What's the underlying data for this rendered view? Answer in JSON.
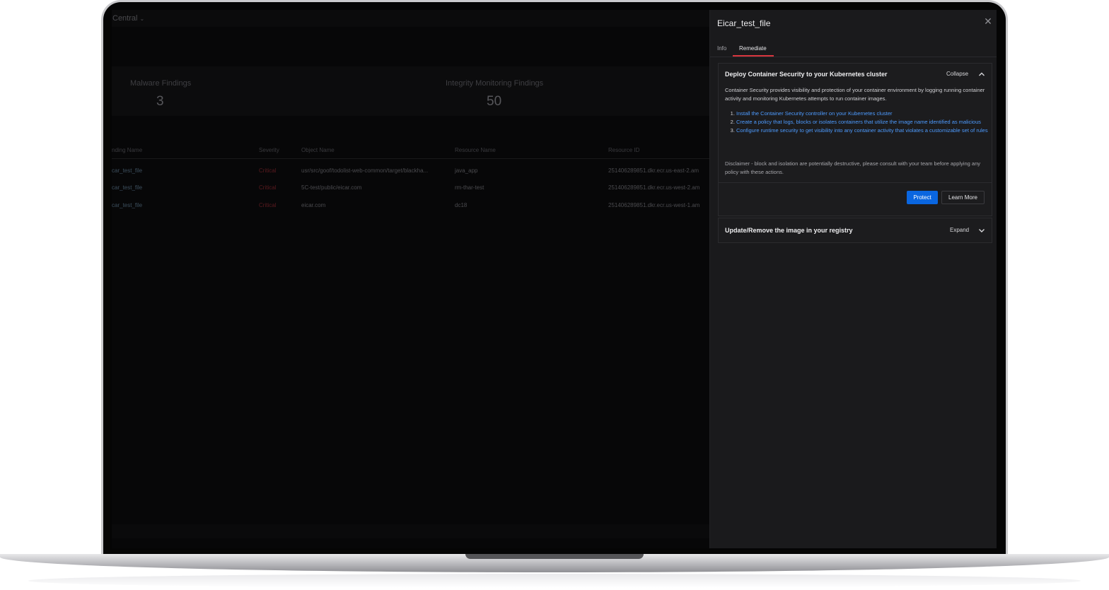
{
  "app": {
    "workspace": "Central",
    "stats": [
      {
        "label": "Malware Findings",
        "value": "3"
      },
      {
        "label": "Integrity Monitoring Findings",
        "value": "50"
      }
    ],
    "table": {
      "headers": [
        "nding Name",
        "Severity",
        "Object Name",
        "Resource Name",
        "Resource ID"
      ],
      "rows": [
        [
          "car_test_file",
          "Critical",
          "usr/src/goof/todolist-web-common/target/blackha...",
          "java_app",
          "251406289851.dkr.ecr.us-east-2.am"
        ],
        [
          "car_test_file",
          "Critical",
          "5C-test/public/eicar.com",
          "rm-thar-test",
          "251406289851.dkr.ecr.us-west-2.am"
        ],
        [
          "car_test_file",
          "Critical",
          "eicar.com",
          "dc18",
          "251406289851.dkr.ecr.us-west-1.am"
        ]
      ]
    }
  },
  "drawer": {
    "title": "Eicar_test_file",
    "tabs": [
      "Info",
      "Remediate"
    ],
    "active_tab": "Remediate",
    "panels": [
      {
        "title": "Deploy Container Security to your Kubernetes cluster",
        "toggle": "Collapse",
        "description": "Container Security provides visibility and protection of your container environment by logging running container activity and monitoring Kubernetes attempts to run container images.",
        "steps": [
          "Install the Container Security controller on your Kubernetes cluster",
          "Create a policy that logs, blocks or isolates containers that utilize the image name identified as malicious",
          "Configure runtime security to get visibility into any container activity that violates a customizable set of rules"
        ],
        "disclaimer": "Disclaimer - block and isolation are potentially destructive, please consult with your team before applying any policy with these actions.",
        "buttons": {
          "primary": "Protect",
          "secondary": "Learn More"
        }
      },
      {
        "title": "Update/Remove the image in your registry",
        "toggle": "Expand"
      }
    ]
  },
  "colors": {
    "accent": "#0a66e0",
    "link": "#4d9bff",
    "tab_underline": "#d9363e",
    "critical": "#5a1a1f"
  }
}
